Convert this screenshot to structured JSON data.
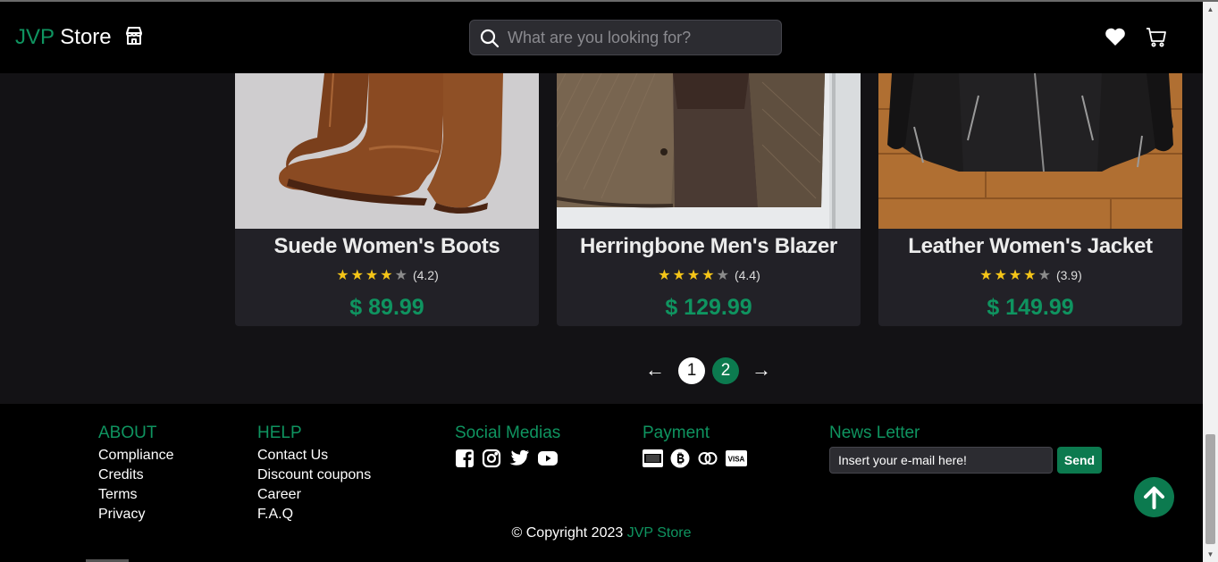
{
  "header": {
    "brand_first": "JVP",
    "brand_second": "Store",
    "search_placeholder": "What are you looking for?"
  },
  "products": [
    {
      "name": "Suede Women's Boots",
      "rating": 4.2,
      "rating_text": "(4.2)",
      "stars_filled": 4,
      "price": "$ 89.99"
    },
    {
      "name": "Herringbone Men's Blazer",
      "rating": 4.4,
      "rating_text": "(4.4)",
      "stars_filled": 4,
      "price": "$ 129.99"
    },
    {
      "name": "Leather Women's Jacket",
      "rating": 3.9,
      "rating_text": "(3.9)",
      "stars_filled": 4,
      "price": "$ 149.99"
    }
  ],
  "pagination": {
    "prev": "←",
    "pages": [
      "1",
      "2"
    ],
    "current": "2",
    "next": "→"
  },
  "footer": {
    "about": {
      "title": "ABOUT",
      "links": [
        "Compliance",
        "Credits",
        "Terms",
        "Privacy"
      ]
    },
    "help": {
      "title": "HELP",
      "links": [
        "Contact Us",
        "Discount coupons",
        "Career",
        "F.A.Q"
      ]
    },
    "social": {
      "title": "Social Medias",
      "icons": [
        "facebook-icon",
        "instagram-icon",
        "twitter-icon",
        "youtube-icon"
      ]
    },
    "payment": {
      "title": "Payment",
      "icons": [
        "american-express-icon",
        "bitcoin-icon",
        "mastercard-icon",
        "visa-icon"
      ]
    },
    "newsletter": {
      "title": "News Letter",
      "placeholder": "Insert your e-mail here!",
      "button": "Send"
    },
    "copyright_prefix": "© Copyright 2023",
    "copyright_brand": "JVP Store"
  },
  "colors": {
    "accent": "#0f9460",
    "header_bg": "#000000",
    "page_bg": "#131215",
    "card_bg": "#222127",
    "star": "#f5c518"
  }
}
